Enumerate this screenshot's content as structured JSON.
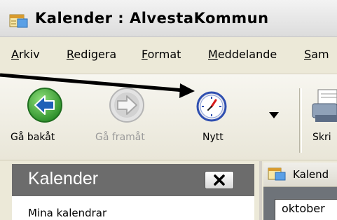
{
  "window": {
    "title": "Kalender : AlvestaKommun",
    "icon": "calendar-app-icon"
  },
  "menu": {
    "items": [
      {
        "key": "A",
        "rest": "rkiv"
      },
      {
        "key": "R",
        "rest": "edigera"
      },
      {
        "key": "F",
        "rest": "ormat"
      },
      {
        "key": "M",
        "rest": "eddelande"
      },
      {
        "key": "S",
        "rest": "am"
      }
    ]
  },
  "toolbar": {
    "back_label": "Gå bakåt",
    "forward_label": "Gå framåt",
    "new_label": "Nytt",
    "print_label": "Skri",
    "back_icon": "back-arrow-icon",
    "forward_icon": "forward-arrow-icon",
    "new_icon": "clock-icon",
    "dropdown_icon": "dropdown-arrow-icon",
    "print_icon": "printer-icon"
  },
  "nav_pane": {
    "title": "Kalender",
    "close_icon": "close-icon",
    "subtitle": "Mina kalendrar"
  },
  "content_pane": {
    "title": "Kalend",
    "month": "oktober"
  },
  "colors": {
    "back_green": "#3aa63a",
    "back_arrow_blue": "#1f5fb8",
    "nav_header": "#6c6c6c",
    "annotation_arrow": "#000000"
  }
}
